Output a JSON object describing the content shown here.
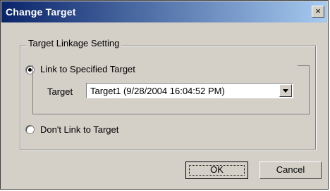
{
  "window": {
    "title": "Change Target",
    "close_symbol": "×"
  },
  "group": {
    "legend": "Target Linkage Setting"
  },
  "options": {
    "link": {
      "label": "Link to Specified Target",
      "checked": true
    },
    "dont_link": {
      "label": "Don't Link to Target",
      "checked": false
    }
  },
  "target": {
    "label": "Target",
    "selected": "Target1 (9/28/2004 16:04:52 PM)"
  },
  "buttons": {
    "ok": "OK",
    "cancel": "Cancel"
  },
  "colors": {
    "titlebar_start": "#0a246a",
    "titlebar_end": "#a6caf0",
    "face": "#d4d0c8"
  }
}
